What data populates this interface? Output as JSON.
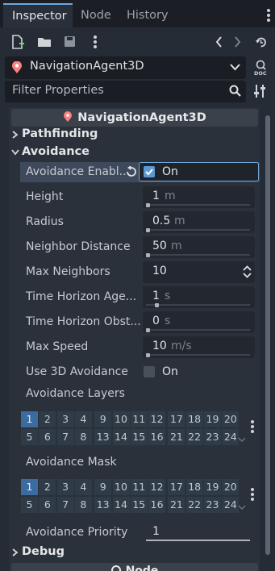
{
  "tabs": [
    {
      "label": "Inspector"
    },
    {
      "label": "Node"
    },
    {
      "label": "History"
    }
  ],
  "node_selector": {
    "label": "NavigationAgent3D"
  },
  "filter": {
    "placeholder": "Filter Properties"
  },
  "header": {
    "title": "NavigationAgent3D"
  },
  "sections": {
    "pathfinding": "Pathfinding",
    "avoidance": "Avoidance",
    "debug": "Debug",
    "node": "Node"
  },
  "properties": {
    "avoidance_enabled": {
      "label": "Avoidance Enabl...",
      "value": "On",
      "checked": true
    },
    "height": {
      "label": "Height",
      "value": "1",
      "unit": "m"
    },
    "radius": {
      "label": "Radius",
      "value": "0.5",
      "unit": "m"
    },
    "neighbor_distance": {
      "label": "Neighbor Distance",
      "value": "50",
      "unit": "m"
    },
    "max_neighbors": {
      "label": "Max Neighbors",
      "value": "10"
    },
    "time_horizon_agents": {
      "label": "Time Horizon Age...",
      "value": "1",
      "unit": "s"
    },
    "time_horizon_obstacles": {
      "label": "Time Horizon Obst...",
      "value": "0",
      "unit": "s"
    },
    "max_speed": {
      "label": "Max Speed",
      "value": "10",
      "unit": "m/s"
    },
    "use_3d_avoidance": {
      "label": "Use 3D Avoidance",
      "value": "On",
      "checked": false
    },
    "avoidance_layers": {
      "label": "Avoidance Layers",
      "active": [
        1
      ]
    },
    "avoidance_mask": {
      "label": "Avoidance Mask",
      "active": [
        1
      ]
    },
    "avoidance_priority": {
      "label": "Avoidance Priority",
      "value": "1"
    }
  },
  "layer_numbers": {
    "row1": [
      "1",
      "2",
      "3",
      "4",
      "9",
      "10",
      "11",
      "12",
      "17",
      "18",
      "19",
      "20"
    ],
    "row2": [
      "5",
      "6",
      "7",
      "8",
      "13",
      "14",
      "15",
      "16",
      "21",
      "22",
      "23",
      "24"
    ]
  },
  "colors": {
    "accent": "#6fa8dc",
    "active_layer": "#3b6b9f",
    "checkbox": "#5b9ad6"
  }
}
